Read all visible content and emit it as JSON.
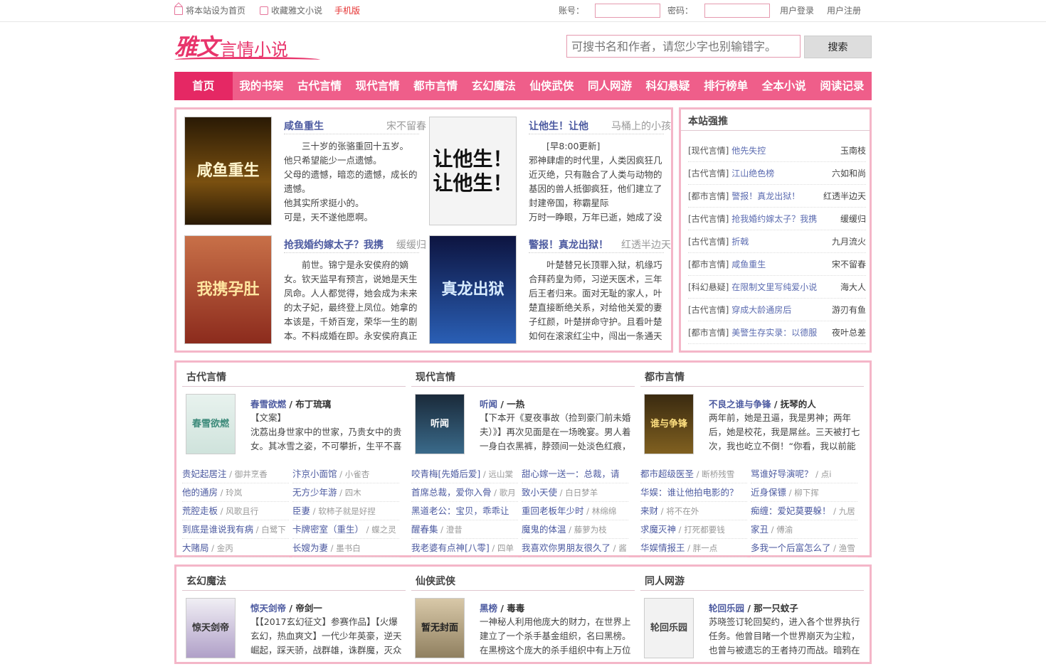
{
  "topbar": {
    "set_home": "将本站设为首页",
    "favorite": "收藏雅文小说",
    "mobile": "手机版",
    "account_label": "账号：",
    "password_label": "密码：",
    "login": "用户登录",
    "register": "用户注册"
  },
  "logo": {
    "big": "雅文",
    "small": "言情小说"
  },
  "search": {
    "placeholder": "可搜书名和作者，请您少字也别输错字。",
    "button": "搜索"
  },
  "nav": [
    "首页",
    "我的书架",
    "古代言情",
    "现代言情",
    "都市言情",
    "玄幻魔法",
    "仙侠武侠",
    "同人网游",
    "科幻悬疑",
    "排行榜单",
    "全本小说",
    "阅读记录"
  ],
  "featured": [
    {
      "title": "咸鱼重生",
      "author": "宋不留春",
      "cover_text": "咸鱼重生",
      "desc": "　　三十岁的张骆重回十五岁。\n他只希望能少一点遗憾。\n父母的遗憾，暗恋的遗憾，成长的遗憾。\n他其实所求挺小的。\n可是，天不遂他愿啊。"
    },
    {
      "title": "让他生！让他",
      "author": "马桶上的小孩",
      "cover_text": "让他生！让他生！",
      "desc": "　　[早8:00更新]\n邪神肆虐的时代里，人类因疯狂几近灭绝，只有融合了人类与动物的基因的兽人抵御疯狂，他们建立了封建帝国，称霸星际\n万时一睁眼，万年已逝，她成了没"
    },
    {
      "title": "抢我婚约嫁太子？我携",
      "author": "缓缓归",
      "cover_text": "我携孕肚",
      "desc": "　　前世。锦宁是永安侯府的嫡女。钦天监早有预言，说她是天生凤命。人人都觉得，她会成为未来的太子妃，最终登上凤位。她拿的本该是，千娇百宠，荣华一生的剧本。不料成婚在即。永安侯府真正"
    },
    {
      "title": "警报！真龙出狱！",
      "author": "红透半边天",
      "cover_text": "真龙出狱",
      "desc": "　　叶楚替兄长顶罪入狱，机缘巧合拜药皇为师，习逆天医术，三年后王者归来。面对无耻的家人，叶楚直接断绝关系，对给他关爱的妻子红颜，叶楚拼命守护。且看叶楚如何在滚滚红尘中，闯出一条通天"
    }
  ],
  "rank": {
    "title": "本站强推",
    "rows": [
      {
        "cat": "[现代言情]",
        "book": "他先失控",
        "author": "玉南枝"
      },
      {
        "cat": "[古代言情]",
        "book": "江山绝色榜",
        "author": "六如和尚"
      },
      {
        "cat": "[都市言情]",
        "book": "警报！真龙出狱！",
        "author": "红透半边天"
      },
      {
        "cat": "[古代言情]",
        "book": "抢我婚约嫁太子？我携",
        "author": "缓缓归"
      },
      {
        "cat": "[古代言情]",
        "book": "折戟",
        "author": "九月流火"
      },
      {
        "cat": "[都市言情]",
        "book": "咸鱼重生",
        "author": "宋不留春"
      },
      {
        "cat": "[科幻悬疑]",
        "book": "在限制文里写纯爱小说",
        "author": "海大人"
      },
      {
        "cat": "[古代言情]",
        "book": "穿成大龄通房后",
        "author": "游刃有鱼"
      },
      {
        "cat": "[都市言情]",
        "book": "美警生存实录：以德服",
        "author": "夜叶总差"
      }
    ]
  },
  "sections": [
    {
      "name": "古代言情",
      "top": {
        "book": "春雪欲燃",
        "author": "布丁琉璃",
        "cover_text": "春雪欲燃",
        "desc": "【文案】\n沈荔出身世家中的世家，乃贵女中的贵女。其冰雪之姿，不可攀折，生平不喜者"
      },
      "list": [
        [
          "贵妃起居注",
          "御井烹香"
        ],
        [
          "汴京小面馆",
          "小雀杏"
        ],
        [
          "他的通房",
          "玲岚"
        ],
        [
          "无方少年游",
          "四木"
        ],
        [
          "荒腔走板",
          "风歌且行"
        ],
        [
          "臣妻",
          "软柿子就是好捏"
        ],
        [
          "到底是谁说我有病",
          "白鹭下"
        ],
        [
          "卡牌密室（重生）",
          "蝶之灵"
        ],
        [
          "大赌局",
          "金丙"
        ],
        [
          "长嫂为妻",
          "墨书白"
        ]
      ]
    },
    {
      "name": "现代言情",
      "top": {
        "book": "听闻",
        "author": "一热",
        "cover_text": "听闻",
        "desc": "【下本开《夏夜事故（捡到豪门前未婚夫）》】再次见面是在一场晚宴。男人着一身白衣黑裤，脖颈间一处淡色红痕，慵"
      },
      "list": [
        [
          "咬青梅[先婚后爱]",
          "远山棠"
        ],
        [
          "甜心嫁一送一：总裁，请",
          "",
          ""
        ],
        [
          "首席总裁，爱你入骨",
          "歌月"
        ],
        [
          "致小天使",
          "白日梦羊"
        ],
        [
          "黑道老公：宝贝，乖乖让",
          "",
          ""
        ],
        [
          "重回老板年少时",
          "林绵绵"
        ],
        [
          "醒春集",
          "澄昔"
        ],
        [
          "魔鬼的体温",
          "藤萝为枝"
        ],
        [
          "我老婆有点神[八零]",
          "四单"
        ],
        [
          "我喜欢你男朋友很久了",
          "酱"
        ]
      ]
    },
    {
      "name": "都市言情",
      "top": {
        "book": "不良之谁与争锋",
        "author": "抚琴的人",
        "cover_text": "谁与争锋",
        "desc": "两年前，她是丑逼，我是男神；两年后，她是校花，我是屌丝。三天被打七次，我也屹立不倒！“你看，我以前能保护你，"
      },
      "list": [
        [
          "都市超级医圣",
          "断桥残雪"
        ],
        [
          "骂谁好导演呢？",
          "点i"
        ],
        [
          "华娱：谁让他拍电影的？",
          "",
          ""
        ],
        [
          "近身保镖",
          "柳下挥"
        ],
        [
          "来财",
          "将不在外"
        ],
        [
          "痴缠：爱妃莫要躲！",
          "九居"
        ],
        [
          "求魔灭神",
          "打死都要钱"
        ],
        [
          "家丑",
          "傅渝"
        ],
        [
          "华娱情报王",
          "胖一点"
        ],
        [
          "多我一个后富怎么了",
          "渔雪"
        ]
      ]
    }
  ],
  "sections2": [
    {
      "name": "玄幻魔法",
      "top": {
        "book": "惊天剑帝",
        "author": "帝剑一",
        "cover_text": "惊天剑帝",
        "desc": "【【2017玄幻征文】参赛作品】【火爆玄幻，热血爽文】一代少年英豪，逆天崛起，踩天骄，战群雄，诛群魔，灭众神，"
      }
    },
    {
      "name": "仙侠武侠",
      "top": {
        "book": "黑榜",
        "author": "毒毒",
        "cover_text": "暂无封面",
        "desc": "一神秘人利用他庞大的财力，在世界上建立了一个杀手基金组织，名曰黑榜。在黑榜这个庞大的杀手组织中有上万位成员，"
      }
    },
    {
      "name": "同人网游",
      "top": {
        "book": "轮回乐园",
        "author": "那一只蚊子",
        "cover_text": "轮回乐园",
        "desc": "苏晓签订轮回契约，进入各个世界执行任务。他曾目睹一个世界崩灭为尘粒，也曾与被遗忘的王者持刃而战。暗鸦在低语，"
      }
    }
  ]
}
